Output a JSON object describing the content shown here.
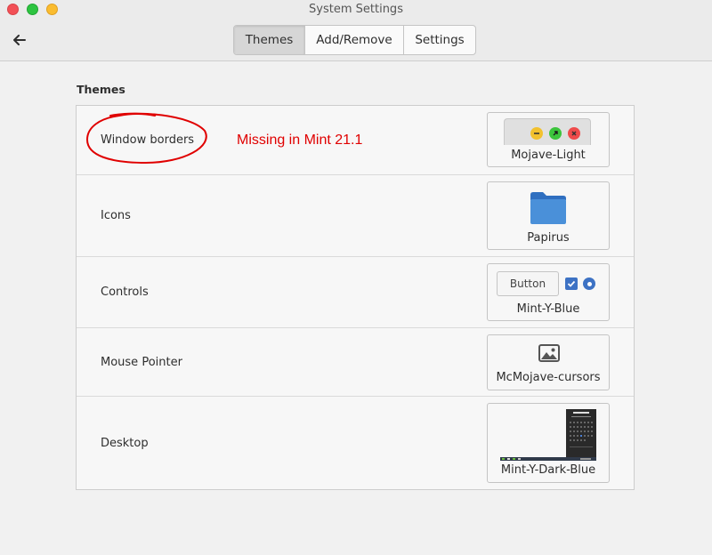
{
  "window": {
    "title": "System Settings"
  },
  "tabs": [
    {
      "label": "Themes",
      "active": true
    },
    {
      "label": "Add/Remove",
      "active": false
    },
    {
      "label": "Settings",
      "active": false
    }
  ],
  "section": {
    "title": "Themes"
  },
  "rows": [
    {
      "label": "Window borders",
      "value": "Mojave-Light"
    },
    {
      "label": "Icons",
      "value": "Papirus"
    },
    {
      "label": "Controls",
      "value": "Mint-Y-Blue"
    },
    {
      "label": "Mouse Pointer",
      "value": "McMojave-cursors"
    },
    {
      "label": "Desktop",
      "value": "Mint-Y-Dark-Blue"
    }
  ],
  "annotation": {
    "text": "Missing in Mint 21.1",
    "color": "#e00000"
  },
  "controls_preview": {
    "button_label": "Button"
  },
  "colors": {
    "accent": "#3d72c4",
    "folder": "#4a90d9"
  }
}
